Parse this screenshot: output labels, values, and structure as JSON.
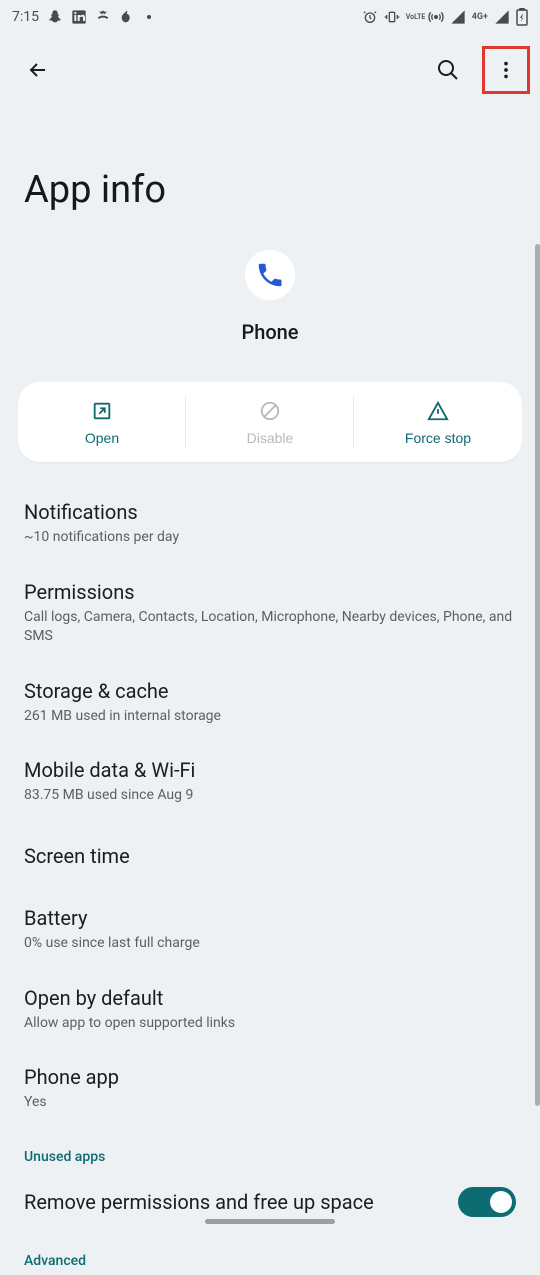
{
  "status": {
    "time": "7:15",
    "network_label": "4G+",
    "volte": "VoLTE"
  },
  "toolbar": {
    "title": "App info"
  },
  "app": {
    "name": "Phone"
  },
  "actions": {
    "open": "Open",
    "disable": "Disable",
    "force_stop": "Force stop"
  },
  "settings": [
    {
      "title": "Notifications",
      "sub": "~10 notifications per day"
    },
    {
      "title": "Permissions",
      "sub": "Call logs, Camera, Contacts, Location, Microphone, Nearby devices, Phone, and SMS"
    },
    {
      "title": "Storage & cache",
      "sub": "261 MB used in internal storage"
    },
    {
      "title": "Mobile data & Wi-Fi",
      "sub": "83.75 MB used since Aug 9"
    },
    {
      "title": "Screen time",
      "sub": ""
    },
    {
      "title": "Battery",
      "sub": "0% use since last full charge"
    },
    {
      "title": "Open by default",
      "sub": "Allow app to open supported links"
    },
    {
      "title": "Phone app",
      "sub": "Yes"
    }
  ],
  "sections": {
    "unused": "Unused apps",
    "advanced": "Advanced"
  },
  "toggle": {
    "remove_permissions": "Remove permissions and free up space"
  }
}
